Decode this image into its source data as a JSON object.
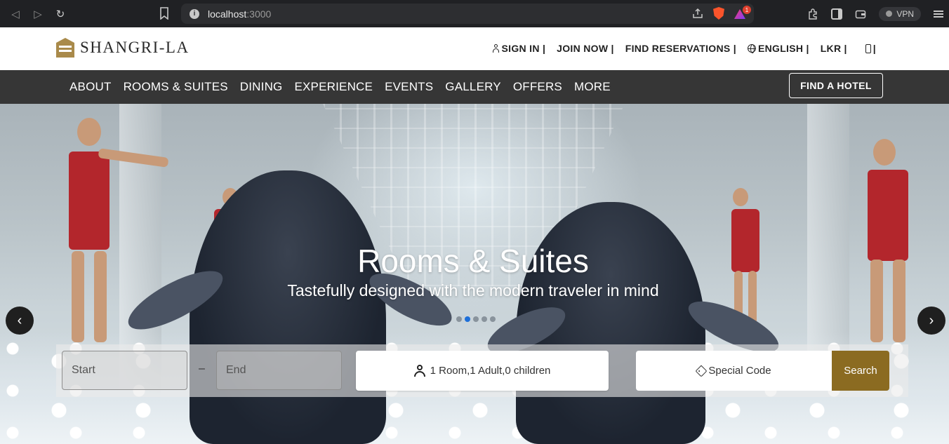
{
  "browser": {
    "url_host": "localhost",
    "url_port": ":3000",
    "notification_count": "1",
    "vpn_label": "VPN"
  },
  "header": {
    "logo_text": "SHANGRI-LA",
    "links": {
      "sign_in": "SIGN IN |",
      "join_now": "JOIN NOW |",
      "find_reservations": "FIND RESERVATIONS |",
      "language": "ENGLISH |",
      "currency": "LKR |",
      "phone_suffix": "|"
    }
  },
  "nav": {
    "items": [
      "ABOUT",
      "ROOMS & SUITES",
      "DINING",
      "EXPERIENCE",
      "EVENTS",
      "GALLERY",
      "OFFERS",
      "MORE"
    ],
    "find_hotel": "FIND A HOTEL"
  },
  "hero": {
    "title": "Rooms & Suites",
    "subtitle": "Tastefully designed with the modern traveler in mind",
    "slide_count": 5,
    "active_slide": 2,
    "prev_arrow": "‹",
    "next_arrow": "›"
  },
  "booking": {
    "start_placeholder": "Start",
    "separator": "–",
    "end_placeholder": "End",
    "guests": "1 Room,1 Adult,0 children",
    "special_code": "Special Code",
    "search": "Search"
  }
}
